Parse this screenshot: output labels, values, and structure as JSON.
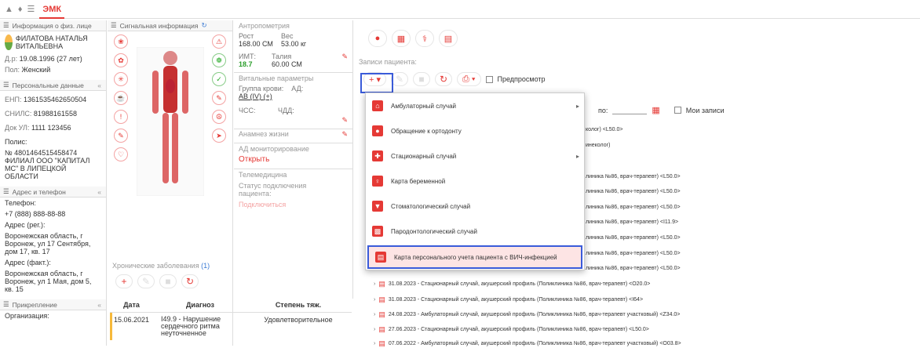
{
  "app": {
    "title": "ЭМК"
  },
  "left": {
    "info_header": "Информация о физ. лице",
    "patient_name": "ФИЛАТОВА НАТАЛЬЯ ВИТАЛЬЕВНА",
    "dob_label": "Д.р:",
    "dob_value": "19.08.1996 (27 лет)",
    "sex_label": "Пол:",
    "sex_value": "Женский",
    "personal_header": "Персональные данные",
    "enp_label": "ЕНП:",
    "enp_value": "1361535462650504",
    "snils_label": "СНИЛС:",
    "snils_value": "81988161558",
    "doc_label": "Док УЛ:",
    "doc_value": "1111 123456",
    "policy_label": "Полис:",
    "policy_value": "№ 4801464515458474 ФИЛИАЛ ООО \"КАПИТАЛ МС\" В ЛИПЕЦКОЙ ОБЛАСТИ",
    "address_header": "Адрес и телефон",
    "phone_label": "Телефон:",
    "phone_value": "+7 (888) 888-88-88",
    "addr_reg_label": "Адрес (рег.):",
    "addr_reg_value": "Воронежская область, г Воронеж, ул 17 Сентября, дом 17, кв. 17",
    "addr_fact_label": "Адрес (факт.):",
    "addr_fact_value": "Воронежская область, г Воронеж, ул 1 Мая, дом 5, кв. 15",
    "attach_header": "Прикрепление",
    "org_label": "Организация:"
  },
  "signal": {
    "header": "Сигнальная информация",
    "chronic_header": "Хронические заболевания",
    "chronic_count": "(1)",
    "table_headers": [
      "Дата",
      "Диагноз",
      "Степень тяж."
    ],
    "rows": [
      {
        "date": "15.06.2021",
        "diag": "I49.9 - Нарушение сердечного ритма неуточненное",
        "severity": "Удовлетворительное"
      }
    ]
  },
  "anthro": {
    "header": "Антропометрия",
    "height_label": "Рост",
    "height_value": "168.00 СМ",
    "weight_label": "Вес",
    "weight_value": "53.00 кг",
    "bmi_label": "ИМТ:",
    "bmi_value": "18.7",
    "waist_label": "Талия",
    "waist_value": "60.00 СМ",
    "vital_header": "Витальные параметры",
    "blood_label": "Группа крови:",
    "blood_value": "AB (IV) (+)",
    "ad_label": "АД:",
    "hr_label": "ЧСС:",
    "rr_label": "ЧДД:",
    "anamnesis_header": "Анамнез жизни",
    "ad_monitor_header": "АД мониторирование",
    "open_link": "Открыть",
    "telemed_header": "Телемедицина",
    "status_label": "Статус подключения пациента:",
    "connect_link": "Подключиться"
  },
  "records": {
    "label": "Записи пациента:",
    "preview_label": "Предпросмотр",
    "po_label": "по:",
    "my_records_label": "Мои записи",
    "partial_rows": [
      "колог) <L50.0>",
      "инеколог)",
      "линика №86, врач-терапевт) <L50.0>",
      "линика №86, врач-терапевт) <L50.0>",
      "линика №86, врач-терапевт) <L50.0>",
      "линика №86, врач-терапевт) <I11.9>",
      "линика №86, врач-терапевт) <L50.0>",
      "линика №86, врач-терапевт) <L50.0>",
      "линика №86, врач-терапевт) <L50.0>"
    ],
    "rows": [
      "31.08.2023 - Стационарный случай, акушерский профиль (Поликлиника №86, врач-терапевт) <O20.0>",
      "31.08.2023 - Стационарный случай, акушерский профиль (Поликлиника №86, врач-терапевт) <I64>",
      "24.08.2023 - Амбулаторный случай, акушерский профиль (Поликлиника №86, врач-терапевт участковый) <Z34.0>",
      "27.06.2023 - Стационарный случай, акушерский профиль (Поликлиника №86, врач-терапевт) <L50.0>",
      "07.06.2022 - Амбулаторный случай, акушерский профиль (Поликлиника №86, врач-терапевт участковый) <O03.8>"
    ]
  },
  "menu": {
    "items": [
      {
        "label": "Амбулаторный случай",
        "icon": "house-icon",
        "sub": true
      },
      {
        "label": "Обращение к ортодонту",
        "icon": "head-icon",
        "sub": false
      },
      {
        "label": "Стационарный случай",
        "icon": "hospital-icon",
        "sub": true
      },
      {
        "label": "Карта беременной",
        "icon": "pregnant-icon",
        "sub": false
      },
      {
        "label": "Стоматологический случай",
        "icon": "tooth-icon",
        "sub": false
      },
      {
        "label": "Пародонтологический случай",
        "icon": "gums-icon",
        "sub": false
      },
      {
        "label": "Карта персонального учета пациента с ВИЧ-инфекцией",
        "icon": "document-icon",
        "sub": false
      }
    ]
  }
}
